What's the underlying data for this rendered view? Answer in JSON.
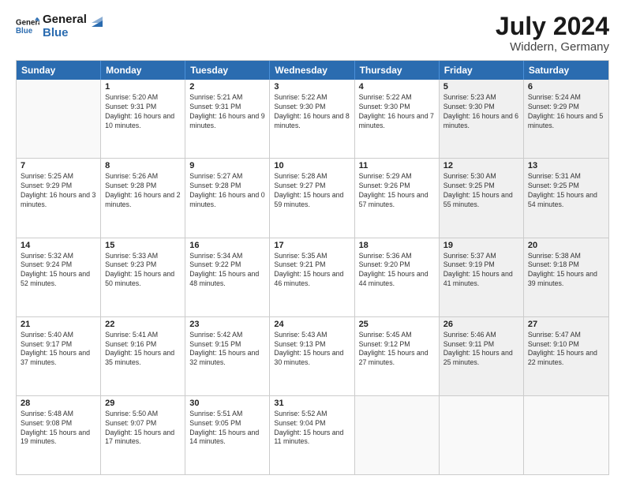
{
  "header": {
    "logo_line1": "General",
    "logo_line2": "Blue",
    "month_title": "July 2024",
    "location": "Widdern, Germany"
  },
  "days_of_week": [
    "Sunday",
    "Monday",
    "Tuesday",
    "Wednesday",
    "Thursday",
    "Friday",
    "Saturday"
  ],
  "weeks": [
    [
      {
        "day": "",
        "sunrise": "",
        "sunset": "",
        "daylight": "",
        "shaded": false,
        "empty": true
      },
      {
        "day": "1",
        "sunrise": "Sunrise: 5:20 AM",
        "sunset": "Sunset: 9:31 PM",
        "daylight": "Daylight: 16 hours and 10 minutes.",
        "shaded": false,
        "empty": false
      },
      {
        "day": "2",
        "sunrise": "Sunrise: 5:21 AM",
        "sunset": "Sunset: 9:31 PM",
        "daylight": "Daylight: 16 hours and 9 minutes.",
        "shaded": false,
        "empty": false
      },
      {
        "day": "3",
        "sunrise": "Sunrise: 5:22 AM",
        "sunset": "Sunset: 9:30 PM",
        "daylight": "Daylight: 16 hours and 8 minutes.",
        "shaded": false,
        "empty": false
      },
      {
        "day": "4",
        "sunrise": "Sunrise: 5:22 AM",
        "sunset": "Sunset: 9:30 PM",
        "daylight": "Daylight: 16 hours and 7 minutes.",
        "shaded": false,
        "empty": false
      },
      {
        "day": "5",
        "sunrise": "Sunrise: 5:23 AM",
        "sunset": "Sunset: 9:30 PM",
        "daylight": "Daylight: 16 hours and 6 minutes.",
        "shaded": true,
        "empty": false
      },
      {
        "day": "6",
        "sunrise": "Sunrise: 5:24 AM",
        "sunset": "Sunset: 9:29 PM",
        "daylight": "Daylight: 16 hours and 5 minutes.",
        "shaded": true,
        "empty": false
      }
    ],
    [
      {
        "day": "7",
        "sunrise": "Sunrise: 5:25 AM",
        "sunset": "Sunset: 9:29 PM",
        "daylight": "Daylight: 16 hours and 3 minutes.",
        "shaded": false,
        "empty": false
      },
      {
        "day": "8",
        "sunrise": "Sunrise: 5:26 AM",
        "sunset": "Sunset: 9:28 PM",
        "daylight": "Daylight: 16 hours and 2 minutes.",
        "shaded": false,
        "empty": false
      },
      {
        "day": "9",
        "sunrise": "Sunrise: 5:27 AM",
        "sunset": "Sunset: 9:28 PM",
        "daylight": "Daylight: 16 hours and 0 minutes.",
        "shaded": false,
        "empty": false
      },
      {
        "day": "10",
        "sunrise": "Sunrise: 5:28 AM",
        "sunset": "Sunset: 9:27 PM",
        "daylight": "Daylight: 15 hours and 59 minutes.",
        "shaded": false,
        "empty": false
      },
      {
        "day": "11",
        "sunrise": "Sunrise: 5:29 AM",
        "sunset": "Sunset: 9:26 PM",
        "daylight": "Daylight: 15 hours and 57 minutes.",
        "shaded": false,
        "empty": false
      },
      {
        "day": "12",
        "sunrise": "Sunrise: 5:30 AM",
        "sunset": "Sunset: 9:25 PM",
        "daylight": "Daylight: 15 hours and 55 minutes.",
        "shaded": true,
        "empty": false
      },
      {
        "day": "13",
        "sunrise": "Sunrise: 5:31 AM",
        "sunset": "Sunset: 9:25 PM",
        "daylight": "Daylight: 15 hours and 54 minutes.",
        "shaded": true,
        "empty": false
      }
    ],
    [
      {
        "day": "14",
        "sunrise": "Sunrise: 5:32 AM",
        "sunset": "Sunset: 9:24 PM",
        "daylight": "Daylight: 15 hours and 52 minutes.",
        "shaded": false,
        "empty": false
      },
      {
        "day": "15",
        "sunrise": "Sunrise: 5:33 AM",
        "sunset": "Sunset: 9:23 PM",
        "daylight": "Daylight: 15 hours and 50 minutes.",
        "shaded": false,
        "empty": false
      },
      {
        "day": "16",
        "sunrise": "Sunrise: 5:34 AM",
        "sunset": "Sunset: 9:22 PM",
        "daylight": "Daylight: 15 hours and 48 minutes.",
        "shaded": false,
        "empty": false
      },
      {
        "day": "17",
        "sunrise": "Sunrise: 5:35 AM",
        "sunset": "Sunset: 9:21 PM",
        "daylight": "Daylight: 15 hours and 46 minutes.",
        "shaded": false,
        "empty": false
      },
      {
        "day": "18",
        "sunrise": "Sunrise: 5:36 AM",
        "sunset": "Sunset: 9:20 PM",
        "daylight": "Daylight: 15 hours and 44 minutes.",
        "shaded": false,
        "empty": false
      },
      {
        "day": "19",
        "sunrise": "Sunrise: 5:37 AM",
        "sunset": "Sunset: 9:19 PM",
        "daylight": "Daylight: 15 hours and 41 minutes.",
        "shaded": true,
        "empty": false
      },
      {
        "day": "20",
        "sunrise": "Sunrise: 5:38 AM",
        "sunset": "Sunset: 9:18 PM",
        "daylight": "Daylight: 15 hours and 39 minutes.",
        "shaded": true,
        "empty": false
      }
    ],
    [
      {
        "day": "21",
        "sunrise": "Sunrise: 5:40 AM",
        "sunset": "Sunset: 9:17 PM",
        "daylight": "Daylight: 15 hours and 37 minutes.",
        "shaded": false,
        "empty": false
      },
      {
        "day": "22",
        "sunrise": "Sunrise: 5:41 AM",
        "sunset": "Sunset: 9:16 PM",
        "daylight": "Daylight: 15 hours and 35 minutes.",
        "shaded": false,
        "empty": false
      },
      {
        "day": "23",
        "sunrise": "Sunrise: 5:42 AM",
        "sunset": "Sunset: 9:15 PM",
        "daylight": "Daylight: 15 hours and 32 minutes.",
        "shaded": false,
        "empty": false
      },
      {
        "day": "24",
        "sunrise": "Sunrise: 5:43 AM",
        "sunset": "Sunset: 9:13 PM",
        "daylight": "Daylight: 15 hours and 30 minutes.",
        "shaded": false,
        "empty": false
      },
      {
        "day": "25",
        "sunrise": "Sunrise: 5:45 AM",
        "sunset": "Sunset: 9:12 PM",
        "daylight": "Daylight: 15 hours and 27 minutes.",
        "shaded": false,
        "empty": false
      },
      {
        "day": "26",
        "sunrise": "Sunrise: 5:46 AM",
        "sunset": "Sunset: 9:11 PM",
        "daylight": "Daylight: 15 hours and 25 minutes.",
        "shaded": true,
        "empty": false
      },
      {
        "day": "27",
        "sunrise": "Sunrise: 5:47 AM",
        "sunset": "Sunset: 9:10 PM",
        "daylight": "Daylight: 15 hours and 22 minutes.",
        "shaded": true,
        "empty": false
      }
    ],
    [
      {
        "day": "28",
        "sunrise": "Sunrise: 5:48 AM",
        "sunset": "Sunset: 9:08 PM",
        "daylight": "Daylight: 15 hours and 19 minutes.",
        "shaded": false,
        "empty": false
      },
      {
        "day": "29",
        "sunrise": "Sunrise: 5:50 AM",
        "sunset": "Sunset: 9:07 PM",
        "daylight": "Daylight: 15 hours and 17 minutes.",
        "shaded": false,
        "empty": false
      },
      {
        "day": "30",
        "sunrise": "Sunrise: 5:51 AM",
        "sunset": "Sunset: 9:05 PM",
        "daylight": "Daylight: 15 hours and 14 minutes.",
        "shaded": false,
        "empty": false
      },
      {
        "day": "31",
        "sunrise": "Sunrise: 5:52 AM",
        "sunset": "Sunset: 9:04 PM",
        "daylight": "Daylight: 15 hours and 11 minutes.",
        "shaded": false,
        "empty": false
      },
      {
        "day": "",
        "sunrise": "",
        "sunset": "",
        "daylight": "",
        "shaded": false,
        "empty": true
      },
      {
        "day": "",
        "sunrise": "",
        "sunset": "",
        "daylight": "",
        "shaded": true,
        "empty": true
      },
      {
        "day": "",
        "sunrise": "",
        "sunset": "",
        "daylight": "",
        "shaded": true,
        "empty": true
      }
    ]
  ]
}
